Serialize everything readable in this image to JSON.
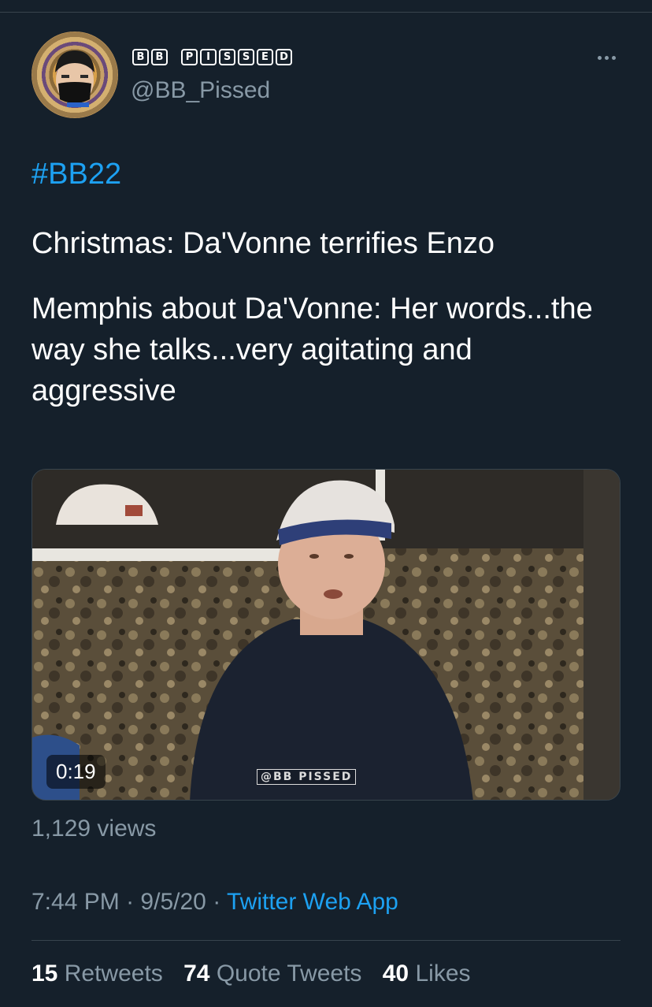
{
  "author": {
    "display_name_tiles": [
      "B",
      "B",
      "P",
      "I",
      "S",
      "S",
      "E",
      "D"
    ],
    "handle": "@BB_Pissed",
    "avatar_icon": "avatar-masked-person-icon",
    "more_icon": "more-options-icon"
  },
  "tweet": {
    "hashtag": "#BB22",
    "line1": "Christmas: Da'Vonne terrifies Enzo",
    "line2": "Memphis about Da'Vonne: Her words...the way she talks...very agitating and aggressive"
  },
  "video": {
    "duration": "0:19",
    "watermark": "@BB PISSED"
  },
  "views": "1,129 views",
  "meta": {
    "time": "7:44 PM",
    "separator": "·",
    "date": "9/5/20",
    "source": "Twitter Web App"
  },
  "stats": {
    "retweets_count": "15",
    "retweets_label": "Retweets",
    "quotes_count": "74",
    "quotes_label": "Quote Tweets",
    "likes_count": "40",
    "likes_label": "Likes"
  },
  "colors": {
    "background": "#15202b",
    "accent": "#1da1f2",
    "secondary_text": "#8899a6"
  }
}
